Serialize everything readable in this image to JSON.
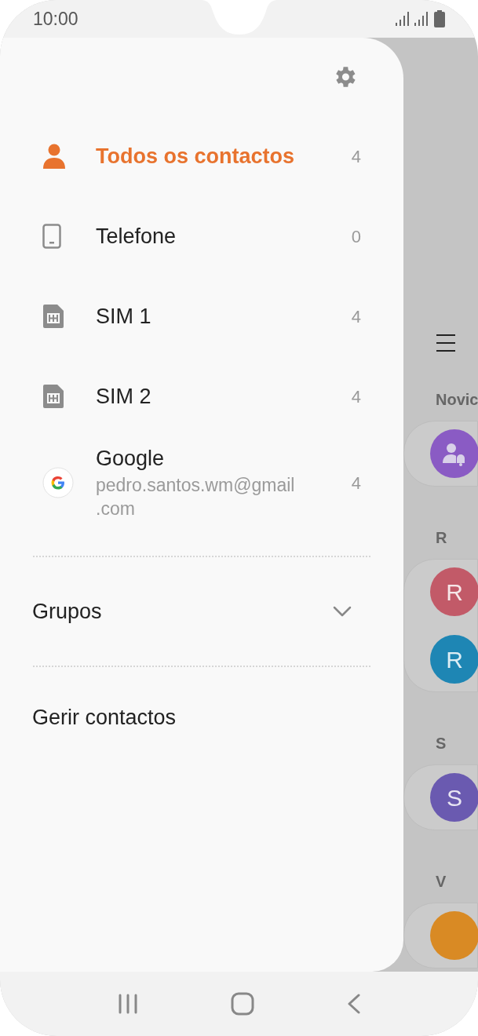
{
  "status_bar": {
    "time": "10:00"
  },
  "drawer": {
    "items": [
      {
        "kind": "person",
        "label": "Todos os contactos",
        "count": "4",
        "selected": true
      },
      {
        "kind": "phone",
        "label": "Telefone",
        "count": "0",
        "selected": false
      },
      {
        "kind": "sim",
        "label": "SIM 1",
        "count": "4",
        "selected": false
      },
      {
        "kind": "sim",
        "label": "SIM 2",
        "count": "4",
        "selected": false
      },
      {
        "kind": "google",
        "label": "Google",
        "subtitle": "pedro.santos.wm@gmail\n.com",
        "count": "4",
        "selected": false
      }
    ],
    "groups": {
      "label": "Grupos",
      "expanded": false
    },
    "manage": {
      "label": "Gerir contactos"
    }
  },
  "contacts": {
    "sections": [
      {
        "header": "Novic",
        "contacts": [
          {
            "kind": "group",
            "color": "#8a5bc4"
          }
        ]
      },
      {
        "header": "R",
        "contacts": [
          {
            "kind": "letter",
            "initial": "R",
            "color": "#c25a68"
          },
          {
            "kind": "letter",
            "initial": "R",
            "color": "#1e86b4"
          }
        ]
      },
      {
        "header": "S",
        "contacts": [
          {
            "kind": "letter",
            "initial": "S",
            "color": "#6a5ab0"
          }
        ]
      },
      {
        "header": "V",
        "contacts": [
          {
            "kind": "letter",
            "color": "#d98a24"
          }
        ]
      }
    ]
  }
}
